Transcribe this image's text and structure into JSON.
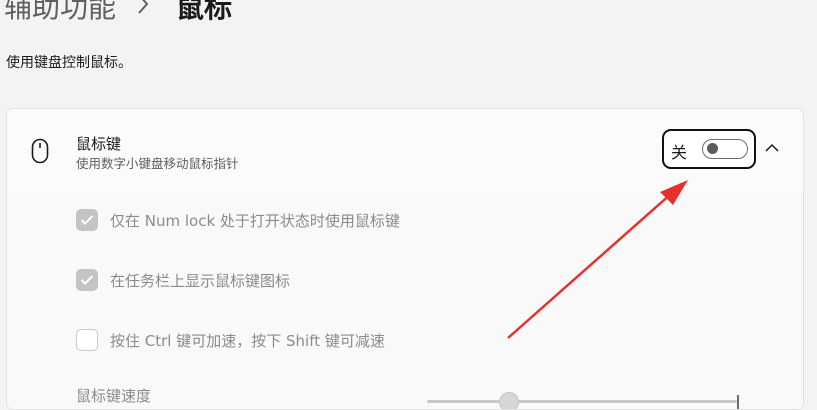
{
  "breadcrumb": {
    "parent": "辅助功能",
    "separator_icon": "chevron-right-icon",
    "current": "鼠标"
  },
  "page_description": "使用键盘控制鼠标。",
  "mouse_keys": {
    "icon": "mouse-icon",
    "title": "鼠标键",
    "subtitle": "使用数字小键盘移动鼠标指针",
    "toggle_state_label": "关",
    "toggle_on": false,
    "expanded": true
  },
  "options": [
    {
      "label": "仅在 Num lock 处于打开状态时使用鼠标键",
      "checked": true,
      "disabled": true
    },
    {
      "label": "在任务栏上显示鼠标键图标",
      "checked": true,
      "disabled": true
    },
    {
      "label": "按住 Ctrl 键可加速，按下 Shift 键可减速",
      "checked": false,
      "disabled": true
    }
  ],
  "speed": {
    "label": "鼠标键速度"
  },
  "colors": {
    "page_bg": "#f3f3f3",
    "card_bg": "#fbfbfb",
    "annotation_arrow": "#e5312b",
    "highlight_border": "#111111",
    "disabled_text": "#8b8b8b"
  }
}
